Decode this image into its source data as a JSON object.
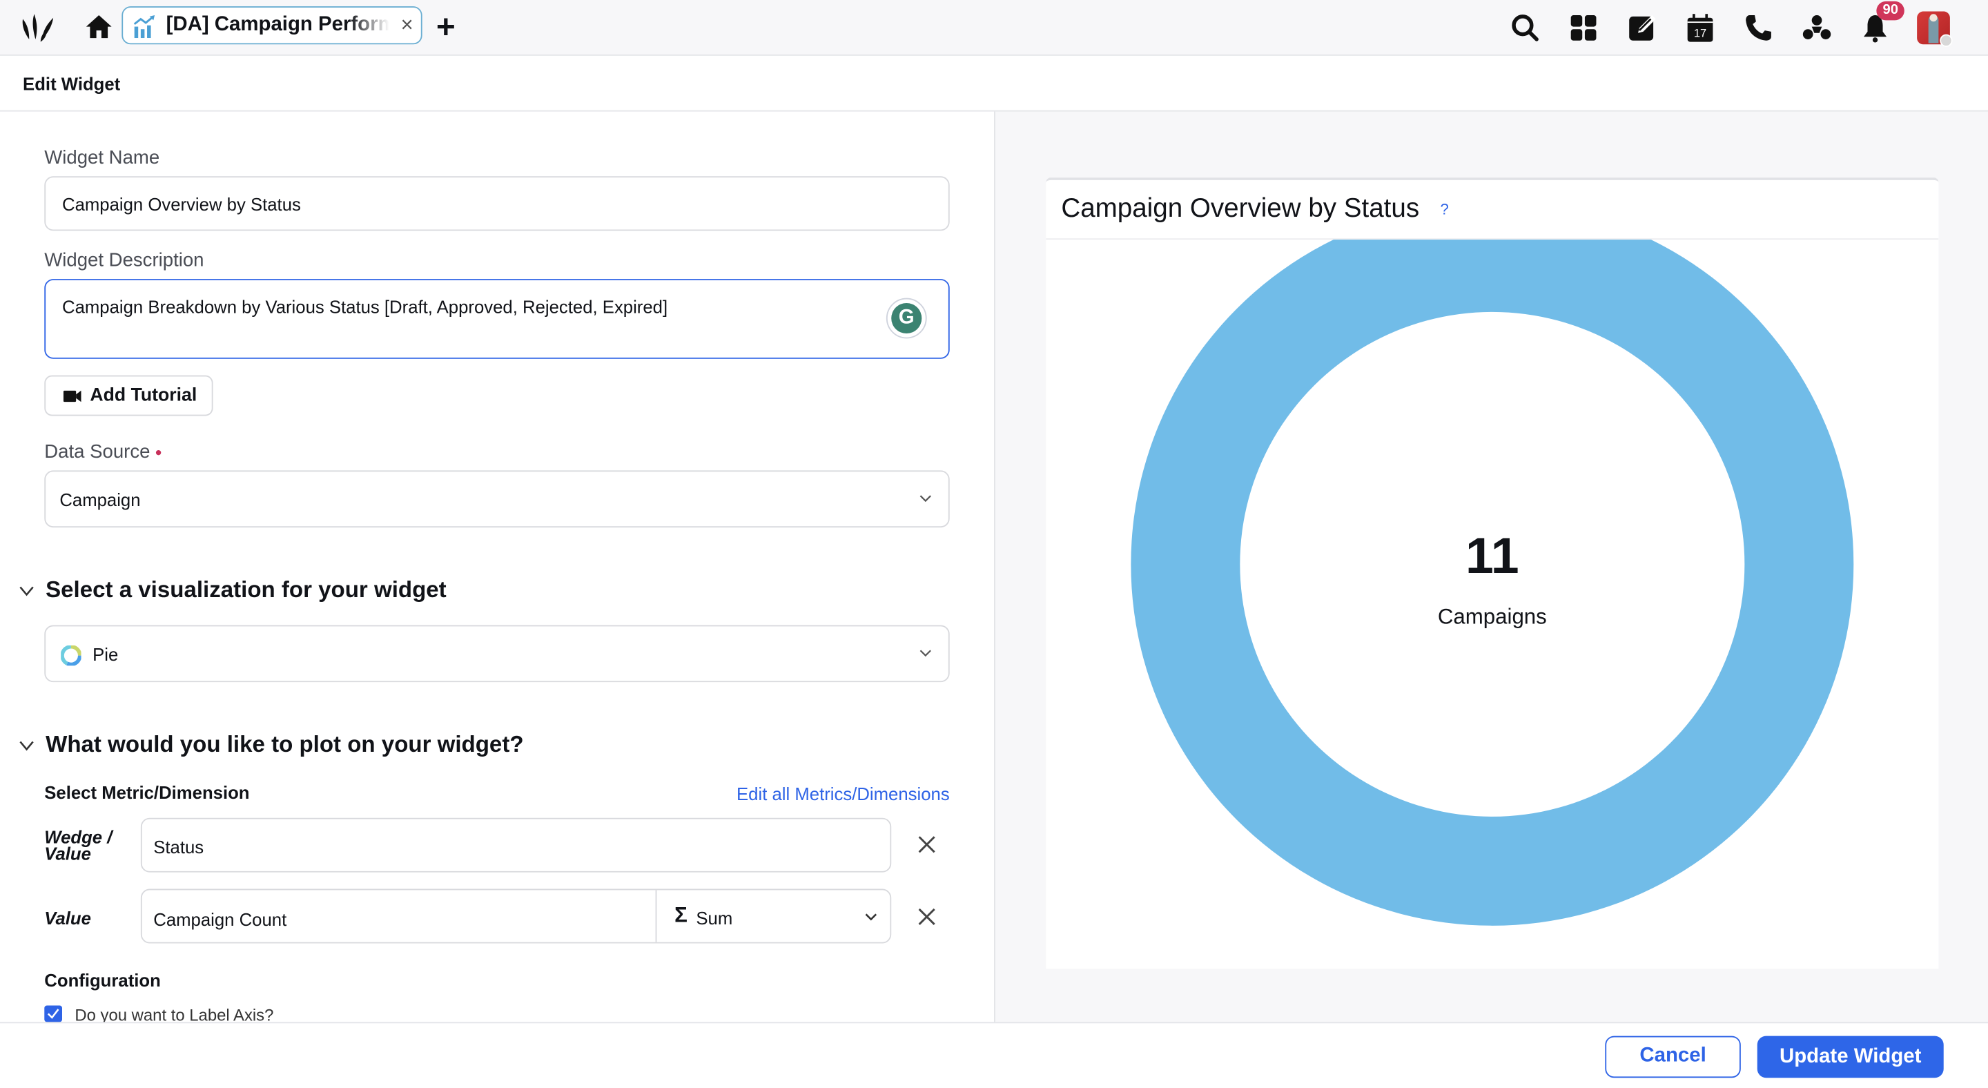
{
  "topbar": {
    "tab_title": "[DA] Campaign Performance",
    "tab_close": "×",
    "add_tab": "+",
    "tools": [
      "search-icon",
      "apps-grid-icon",
      "compose-icon",
      "calendar-icon",
      "phone-icon",
      "community-icon",
      "bell-icon",
      "avatar"
    ],
    "calendar_day": "17",
    "notification_count": "90"
  },
  "header": {
    "title": "Edit Widget"
  },
  "form": {
    "widget_name_label": "Widget Name",
    "widget_name_value": "Campaign Overview by Status",
    "widget_description_label": "Widget Description",
    "widget_description_value": "Campaign Breakdown by Various Status [Draft, Approved, Rejected, Expired]",
    "grammarly_glyph": "G",
    "add_tutorial_label": "Add Tutorial",
    "data_source_label": "Data Source",
    "data_source_value": "Campaign",
    "visualization_section_title": "Select a visualization for your widget",
    "visualization_value": "Pie",
    "plot_section_title": "What would you like to plot on your widget?",
    "select_metric_label": "Select Metric/Dimension",
    "edit_all_link": "Edit all Metrics/Dimensions",
    "rows": [
      {
        "label": "Wedge / Value",
        "value": "Status"
      },
      {
        "label": "Value",
        "value": "Campaign Count",
        "aggregation": "Sum",
        "aggregation_symbol": "Σ"
      }
    ],
    "configuration_label": "Configuration",
    "label_axis_checkbox": {
      "label": "Do you want to Label Axis?",
      "checked": true
    }
  },
  "preview": {
    "card_title": "Campaign Overview by Status",
    "help_glyph": "?",
    "center_value": "11",
    "center_label": "Campaigns"
  },
  "chart_data": {
    "type": "pie",
    "title": "Campaign Overview by Status",
    "variant": "donut",
    "categories": [
      "Campaigns"
    ],
    "values": [
      11
    ],
    "total": 11,
    "total_label": "Campaigns",
    "colors": [
      "#71BCE8"
    ]
  },
  "footer": {
    "cancel_label": "Cancel",
    "update_label": "Update Widget"
  },
  "colors": {
    "accent": "#2E66E8",
    "donut": "#71BCE8",
    "badge": "#D0355A",
    "tab_border": "#6AAED2"
  }
}
